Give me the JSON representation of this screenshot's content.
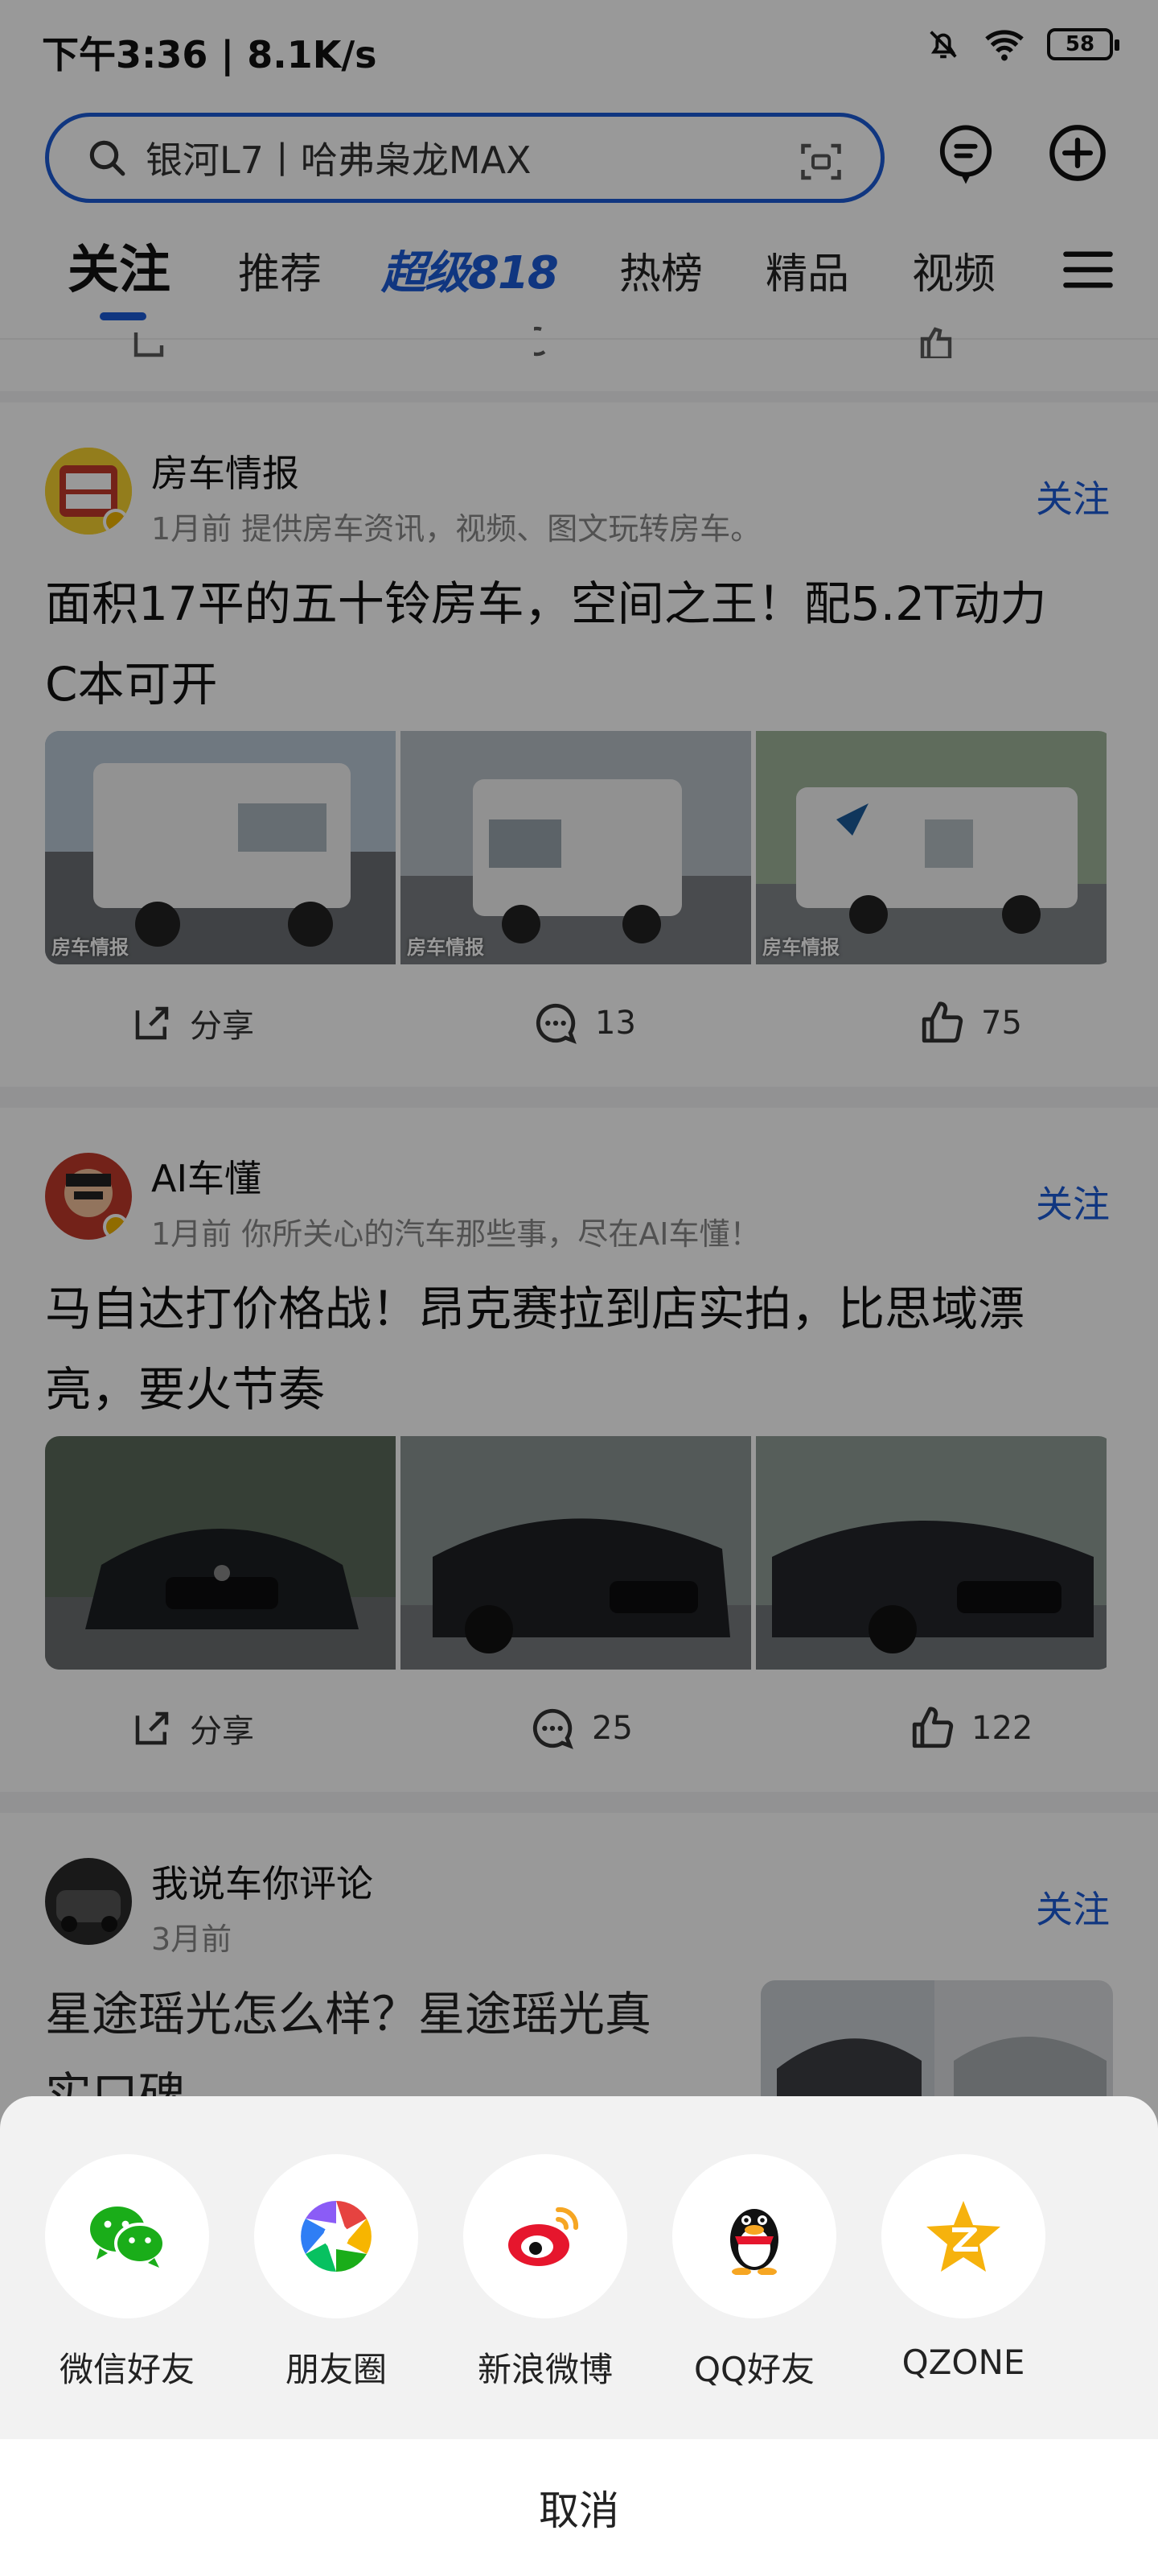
{
  "status_bar": {
    "time_speed": "下午3:36 | 8.1K/s",
    "battery": "58"
  },
  "search": {
    "query": "银河L7丨哈弗枭龙MAX"
  },
  "tabs": [
    "关注",
    "推荐",
    "超级818",
    "热榜",
    "精品",
    "视频"
  ],
  "posts": [
    {
      "author": "房车情报",
      "meta": "1月前 提供房车资讯，视频、图文玩转房车。",
      "follow": "关注",
      "title_line1": "面积17平的五十铃房车，空间之王！配5.2T动力",
      "title_line2": "C本可开",
      "image_tag": "房车情报",
      "share": "分享",
      "comments": "13",
      "likes": "75"
    },
    {
      "author": "AI车懂",
      "meta": "1月前 你所关心的汽车那些事，尽在AI车懂！",
      "follow": "关注",
      "title_line1": "马自达打价格战！昂克赛拉到店实拍，比思域漂",
      "title_line2": "亮，要火节奏",
      "share": "分享",
      "comments": "25",
      "likes": "122"
    },
    {
      "author": "我说车你评论",
      "meta": "3月前",
      "follow": "关注",
      "title_line1": "星途瑶光怎么样？星途瑶光真",
      "title_line2": "实口碑"
    }
  ],
  "share_sheet": {
    "items": [
      "微信好友",
      "朋友圈",
      "新浪微博",
      "QQ好友",
      "QZONE"
    ],
    "cancel": "取消"
  },
  "colors": {
    "accent": "#1b5bd6",
    "wechat": "#1aad19",
    "weibo": "#e6162d",
    "qzone": "#f6b20d"
  }
}
